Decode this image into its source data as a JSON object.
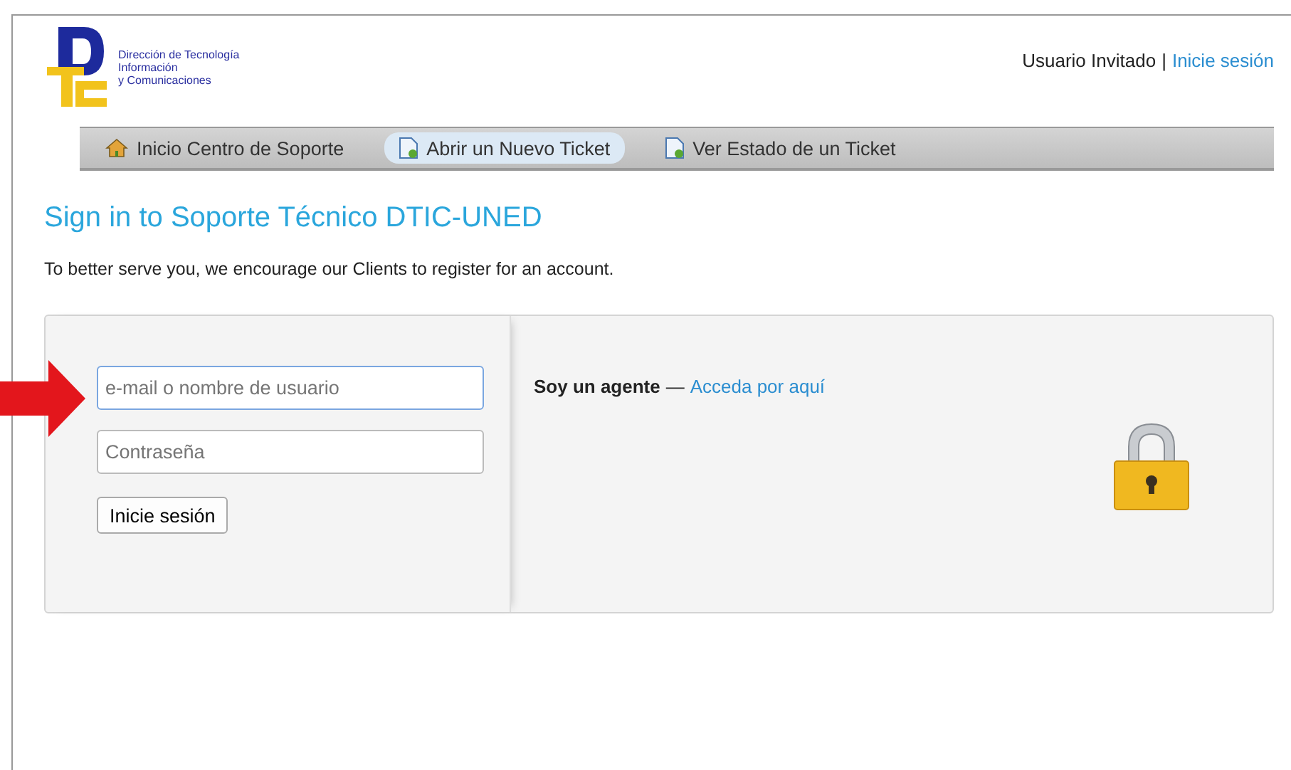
{
  "logo": {
    "lines": [
      "Dirección de Tecnología",
      "Información",
      "y Comunicaciones"
    ]
  },
  "user_bar": {
    "user": "Usuario Invitado",
    "separator": "|",
    "sign_in_link": "Inicie sesión"
  },
  "nav": [
    {
      "label": "Inicio Centro de Soporte",
      "kind": "home",
      "selected": false
    },
    {
      "label": "Abrir un Nuevo Ticket",
      "kind": "new",
      "selected": true
    },
    {
      "label": "Ver Estado de un Ticket",
      "kind": "status",
      "selected": false
    }
  ],
  "title": "Sign in to Soporte Técnico DTIC-UNED",
  "intro": "To better serve you, we encourage our Clients to register for an account.",
  "login": {
    "fields": [
      {
        "placeholder": "e-mail o nombre de usuario",
        "focused": true
      },
      {
        "placeholder": "Contraseña",
        "focused": false
      }
    ],
    "button": "Inicie sesión",
    "agent_text": "Soy un agente",
    "dash": "—",
    "agent_link": "Acceda por aquí"
  }
}
